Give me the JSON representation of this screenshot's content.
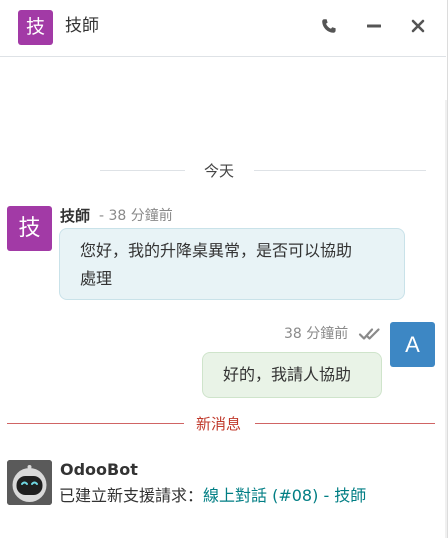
{
  "header": {
    "avatar_char": "技",
    "title": "技師",
    "buttons": [
      "phone-icon",
      "minimize-icon",
      "close-icon"
    ]
  },
  "date_separator": "今天",
  "messages": [
    {
      "author": "技師",
      "avatar_char": "技",
      "meta": "- 38 分鐘前",
      "lines": [
        "您好，我的升降桌異常，是否可以協助",
        "處理"
      ]
    },
    {
      "avatar_char": "A",
      "meta": "38 分鐘前",
      "status": "double-check-icon",
      "text": "好的，我請人協助"
    }
  ],
  "new_messages_separator": "新消息",
  "bot_message": {
    "author": "OdooBot",
    "text": "已建立新支援請求：",
    "link": "線上對話 (#08) - 技師"
  },
  "colors": {
    "tech_avatar": "#a23aa6",
    "user_avatar": "#3d87c4",
    "incoming_bubble": "#e8f3f6",
    "outgoing_bubble": "#e9f3e7",
    "new_separator": "#d06464",
    "link": "#017e84"
  }
}
